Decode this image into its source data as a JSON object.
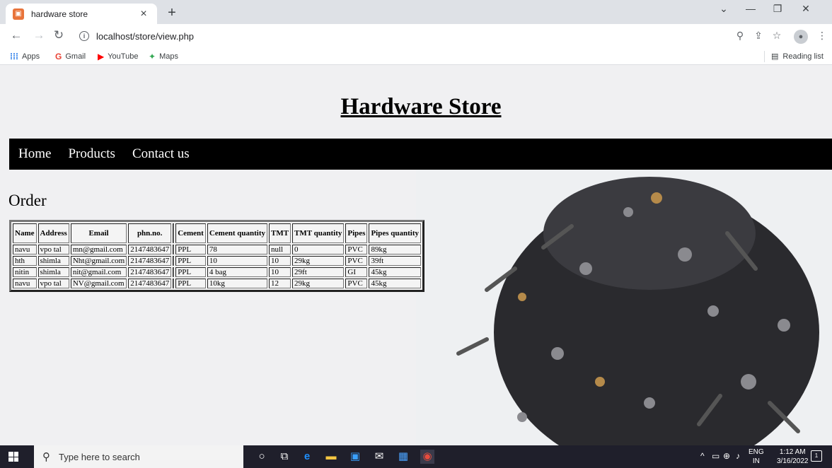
{
  "browser": {
    "tab_title": "hardware store",
    "tab_close": "×",
    "new_tab": "+",
    "url": "localhost/store/view.php",
    "bookmarks": [
      {
        "label": "Apps",
        "icon": "apps-icon"
      },
      {
        "label": "Gmail",
        "icon": "gmail-icon"
      },
      {
        "label": "YouTube",
        "icon": "youtube-icon"
      },
      {
        "label": "Maps",
        "icon": "maps-icon"
      }
    ],
    "reading_list": "Reading list"
  },
  "page": {
    "heading": "Hardware Store",
    "nav": [
      "Home",
      "Products",
      "Contact us"
    ],
    "section_title": "Order",
    "table": {
      "headers": [
        "Name",
        "Address",
        "Email",
        "phn.no.",
        "",
        "Cement",
        "Cement quantity",
        "TMT",
        "TMT quantity",
        "Pipes",
        "Pipes quantity"
      ],
      "rows": [
        [
          "navu",
          "vpo tal",
          "mn@gmail.com",
          "2147483647",
          "",
          "PPL",
          "78",
          "null",
          "0",
          "PVC",
          "89kg"
        ],
        [
          "hth",
          "shimla",
          "Nht@gmail.com",
          "2147483647",
          "",
          "PPL",
          "10",
          "10",
          "29kg",
          "PVC",
          "39ft"
        ],
        [
          "nitin",
          "shimla",
          "nit@gmail.com",
          "2147483647",
          "",
          "PPL",
          "4 bag",
          "10",
          "29ft",
          "GI",
          "45kg"
        ],
        [
          "navu",
          "vpo tal",
          "NV@gmail.com",
          "2147483647",
          "",
          "PPL",
          "10kg",
          "12",
          "29kg",
          "PVC",
          "45kg"
        ]
      ]
    }
  },
  "taskbar": {
    "search_placeholder": "Type here to search",
    "lang_top": "ENG",
    "lang_bottom": "IN",
    "time": "1:12 AM",
    "date": "3/16/2022",
    "notification_count": "1"
  },
  "colors": {
    "nav_bg": "#000000",
    "page_bg": "#f0f0f2",
    "taskbar_bg": "#1f1f2b"
  }
}
